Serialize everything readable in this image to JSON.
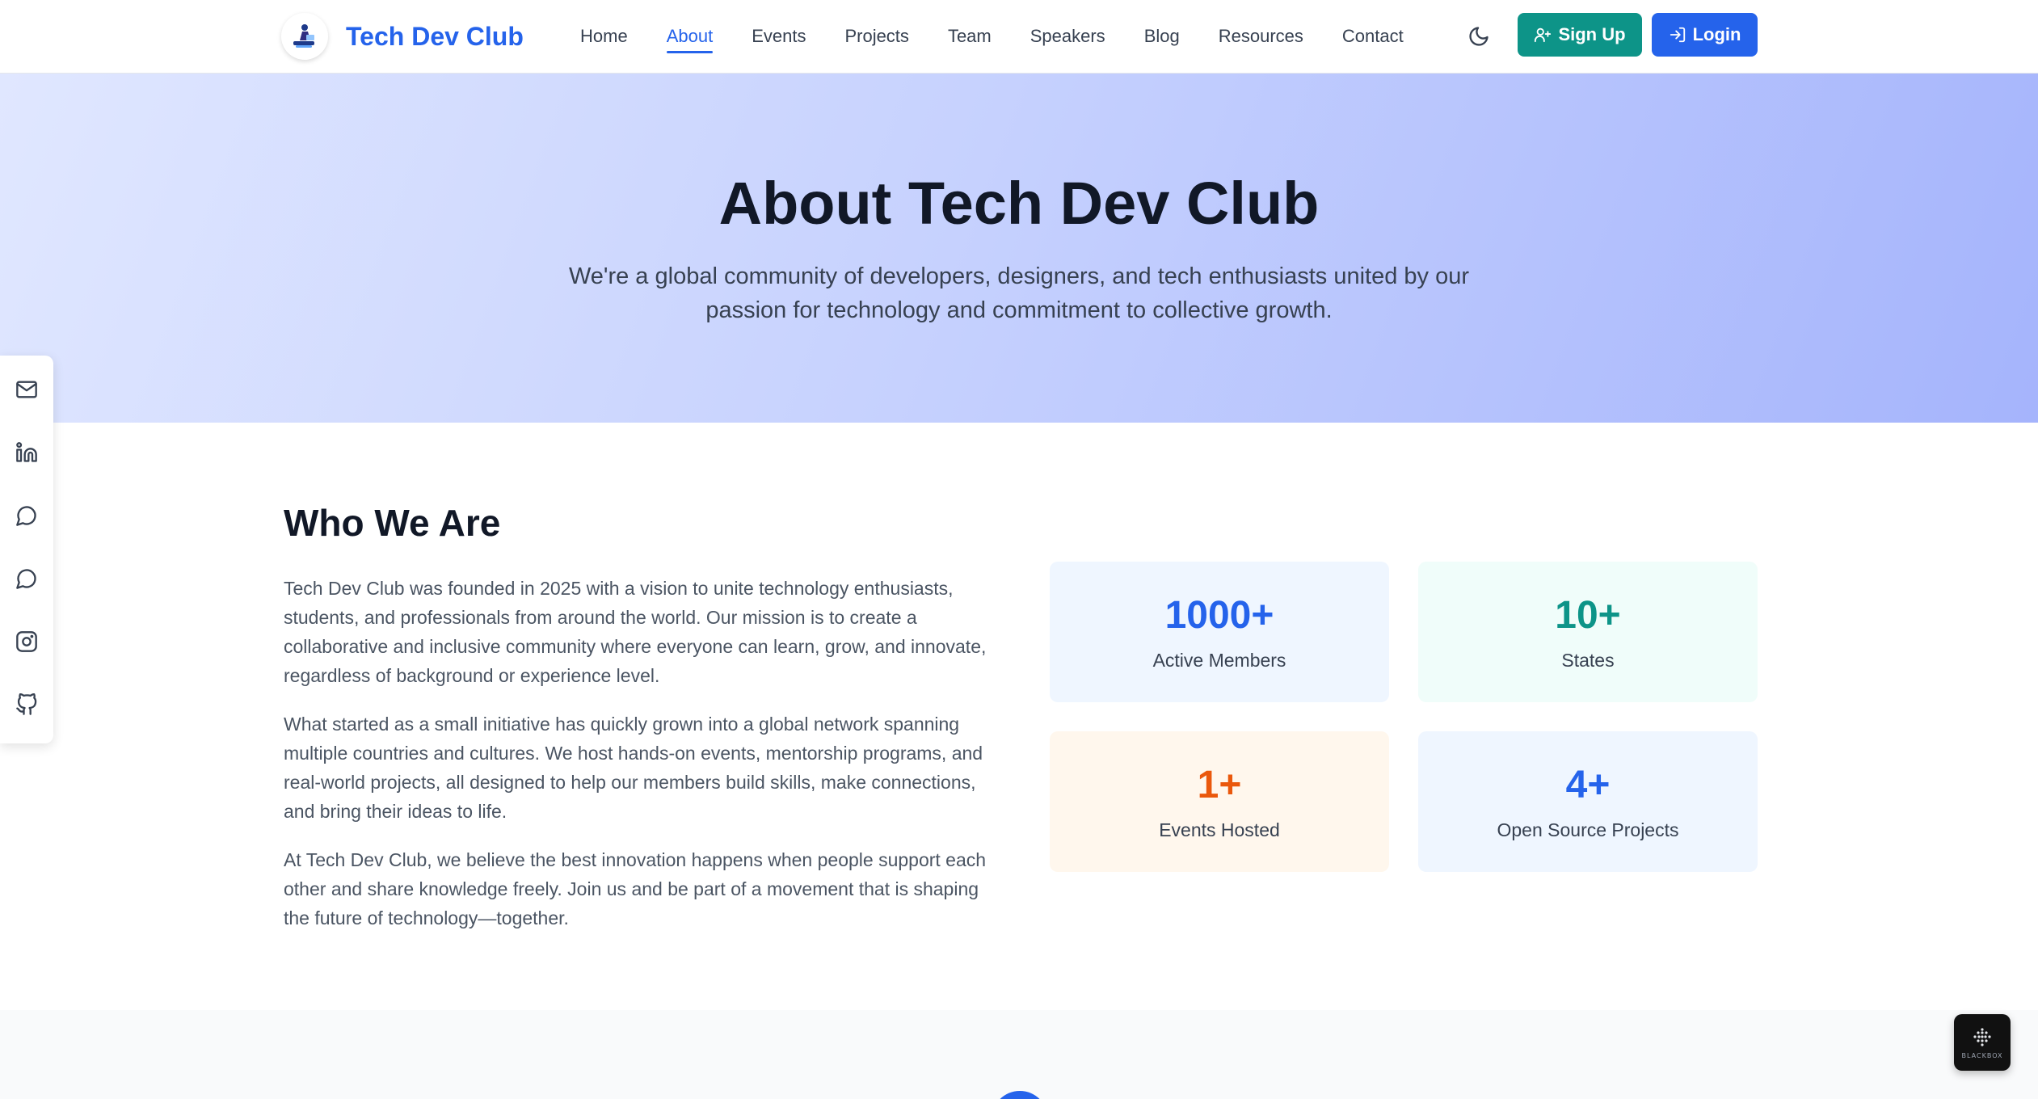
{
  "brand": {
    "name": "Tech Dev Club",
    "accent_color": "#2563eb"
  },
  "nav": {
    "items": [
      {
        "label": "Home",
        "active": false
      },
      {
        "label": "About",
        "active": true
      },
      {
        "label": "Events",
        "active": false
      },
      {
        "label": "Projects",
        "active": false
      },
      {
        "label": "Team",
        "active": false
      },
      {
        "label": "Speakers",
        "active": false
      },
      {
        "label": "Blog",
        "active": false
      },
      {
        "label": "Resources",
        "active": false
      },
      {
        "label": "Contact",
        "active": false
      }
    ],
    "theme_toggle_icon": "moon-icon",
    "signup_label": "Sign Up",
    "login_label": "Login",
    "signup_color": "#0d9488",
    "login_color": "#2563eb"
  },
  "hero": {
    "title": "About Tech Dev Club",
    "subtitle": "We're a global community of developers, designers, and tech enthusiasts united by our passion for technology and commitment to collective growth."
  },
  "social": {
    "icons": [
      "mail-icon",
      "linkedin-icon",
      "chat-icon",
      "message-icon",
      "instagram-icon",
      "github-icon"
    ]
  },
  "who": {
    "title": "Who We Are",
    "paragraphs": [
      "Tech Dev Club was founded in 2025 with a vision to unite technology enthusiasts, students, and professionals from around the world. Our mission is to create a collaborative and inclusive community where everyone can learn, grow, and innovate, regardless of background or experience level.",
      "What started as a small initiative has quickly grown into a global network spanning multiple countries and cultures. We host hands-on events, mentorship programs, and real-world projects, all designed to help our members build skills, make connections, and bring their ideas to life.",
      "At Tech Dev Club, we believe the best innovation happens when people support each other and share knowledge freely. Join us and be part of a movement that is shaping the future of technology—together."
    ]
  },
  "stats": [
    {
      "value": "1000+",
      "label": "Active Members",
      "color": "#2563eb"
    },
    {
      "value": "10+",
      "label": "States",
      "color": "#0d9488"
    },
    {
      "value": "1+",
      "label": "Events Hosted",
      "color": "#ea580c"
    },
    {
      "value": "4+",
      "label": "Open Source Projects",
      "color": "#2563eb"
    }
  ],
  "widget": {
    "label": "BLACKBOX",
    "icon": "blackbox-icon"
  }
}
